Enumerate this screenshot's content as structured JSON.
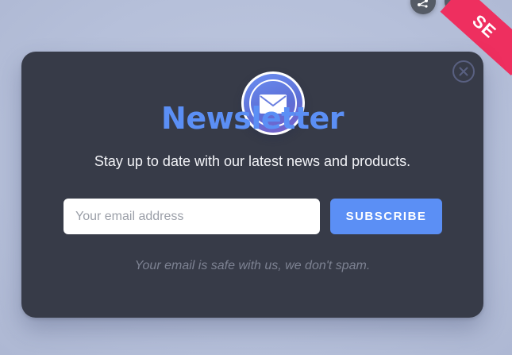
{
  "page": {
    "background_color": "#b8c2db"
  },
  "top_controls": {
    "button_one_icon": "share-icon",
    "button_two_icon": "more-vertical-icon",
    "ribbon_text": "SE",
    "ribbon_color": "#ee2f5f"
  },
  "modal": {
    "background_color": "#373b48",
    "badge_icon": "envelope-icon",
    "close_icon": "close-icon",
    "title": "Newsletter",
    "subtitle": "Stay up to date with our latest news and products.",
    "email_input": {
      "value": "",
      "placeholder": "Your email address"
    },
    "subscribe_label": "SUBSCRIBE",
    "accent_color": "#5b8ff5",
    "note": "Your email is safe with us, we don't spam."
  }
}
